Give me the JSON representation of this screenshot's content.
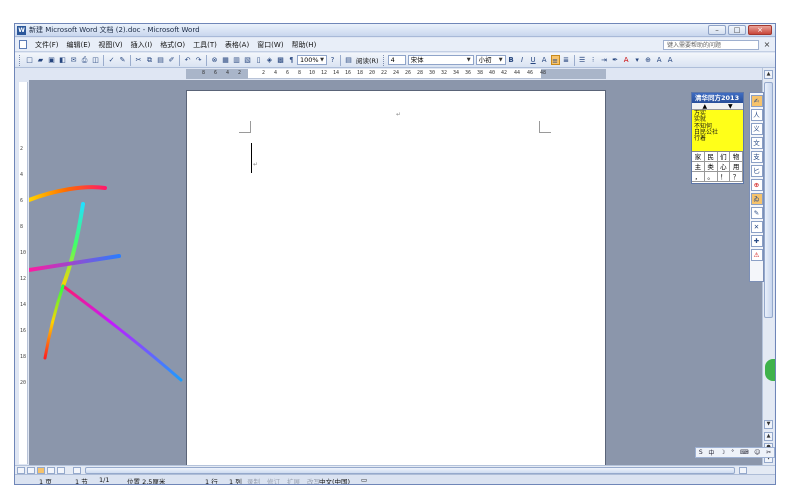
{
  "window": {
    "title": "新建 Microsoft Word 文档 (2).doc - Microsoft Word",
    "min_btn": "–",
    "max_btn": "□",
    "close_btn": "×"
  },
  "menubar": {
    "items": [
      "文件(F)",
      "编辑(E)",
      "视图(V)",
      "插入(I)",
      "格式(O)",
      "工具(T)",
      "表格(A)",
      "窗口(W)",
      "帮助(H)"
    ],
    "help_placeholder": "键入需要帮助的问题",
    "close_doc": "×"
  },
  "toolbar": {
    "zoom": "100%",
    "read_label": "阅读(R)",
    "style": "4",
    "font": "宋体",
    "size": "小初",
    "bold": "B",
    "italic": "I",
    "underline": "U",
    "char_scale": "A"
  },
  "ruler": {
    "h_ticks": [
      "8",
      "6",
      "4",
      "2",
      "2",
      "4",
      "6",
      "8",
      "10",
      "12",
      "14",
      "16",
      "18",
      "20",
      "22",
      "24",
      "26",
      "28",
      "30",
      "32",
      "34",
      "36",
      "38",
      "40",
      "42",
      "44",
      "46",
      "48"
    ],
    "v_ticks": [
      "2",
      "4",
      "6",
      "8",
      "10",
      "12",
      "14",
      "16",
      "18",
      "20"
    ]
  },
  "status": {
    "page": "1 页",
    "section": "1 节",
    "page_of": "1/1",
    "position": "位置 2.5厘米",
    "line": "1 行",
    "column": "1 列",
    "rec": "录制",
    "trk": "修订",
    "ext": "扩展",
    "ovr": "改写",
    "lang": "中文(中国)"
  },
  "ime": {
    "title": "清华同方2013",
    "nav_up": "▲",
    "nav_down": "▼",
    "candidates": [
      "万实",
      "实就",
      "不知何",
      "日民公社",
      "行着"
    ],
    "grid": [
      "家",
      "民",
      "们",
      "物",
      "主",
      "类",
      "心",
      "用",
      "，",
      "。",
      "！",
      "？"
    ],
    "side_buttons": [
      "人",
      "义",
      "文",
      "支",
      "匕",
      "⊕",
      "ゐ",
      "✎",
      "✕",
      "✚",
      "⚠"
    ],
    "tray": [
      "S",
      "中",
      "☽",
      "°",
      "⌨",
      "☺",
      "✂"
    ]
  }
}
